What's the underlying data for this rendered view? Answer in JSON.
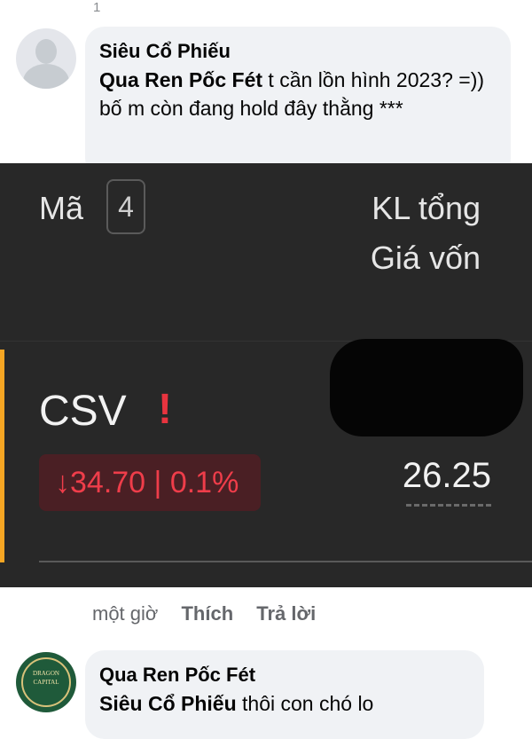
{
  "top_cutoff": "1",
  "comment1": {
    "author": "Siêu Cổ Phiếu",
    "mention": "Qua Ren Pốc Fét",
    "text": " t cần lồn hình 2023? =)) bố m còn đang hold đây thằng ***"
  },
  "embedded_screenshot": {
    "column_code_label": "Mã",
    "count_badge": "4",
    "column_volume_label": "KL tổng",
    "column_cost_label": "Giá vốn",
    "ticker": "CSV",
    "warning_symbol": "!",
    "change_arrow": "↓",
    "price": "34.70",
    "change_separator": " | ",
    "change_pct": "0.1%",
    "cost_price": "26.25"
  },
  "comment1_actions": {
    "time": "một giờ",
    "like": "Thích",
    "reply": "Trả lời"
  },
  "comment2": {
    "author": "Qua Ren Pốc Fét",
    "mention": "Siêu Cổ Phiếu",
    "text": " thôi con chó lo"
  },
  "logo_text": {
    "line1": "DRAGON",
    "line2": "CAPITAL"
  },
  "colors": {
    "bubble_bg": "#f0f2f5",
    "dark_bg": "#282828",
    "accent_bar": "#f6a623",
    "loss_red": "#ef3d4a",
    "meta_gray": "#65676b"
  }
}
